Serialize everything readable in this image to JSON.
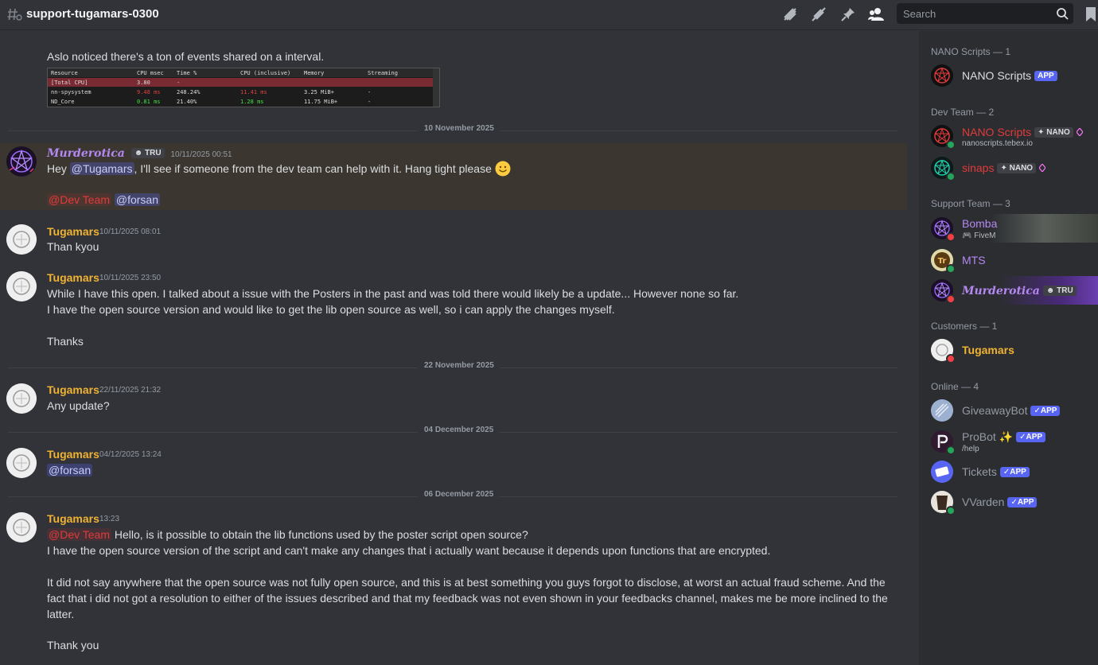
{
  "header": {
    "channel": "support-tugamars-0300",
    "search_placeholder": "Search"
  },
  "messages": {
    "m0_text": "Aslo noticed there's a ton of events shared on a interval.",
    "embed": {
      "headers": [
        "Resource",
        "CPU msec",
        "Time %",
        "CPU (inclusive)",
        "Memory",
        "Streaming"
      ],
      "rows": [
        [
          "[Total CPU]",
          "3.80",
          "-",
          "",
          "",
          ""
        ],
        [
          "nn-spysystem",
          "9.48 ms",
          "248.24%",
          "11.41 ms",
          "3.25 MiB+",
          "-"
        ],
        [
          "ND_Core",
          "0.81 ms",
          "21.40%",
          "1.28 ms",
          "11.75 MiB+",
          "-"
        ]
      ]
    },
    "d1": "10 November 2025",
    "m1": {
      "user": "Murderotica",
      "guild_tag": "TRU",
      "time": "10/11/2025 00:51",
      "l1a": "Hey ",
      "l1_mention": "@Tugamars",
      "l1b": ", I'll see if someone from the dev team can help with it.  Hang tight please",
      "mention_role": "@Dev Team",
      "mention_user": "@forsan"
    },
    "m2": {
      "user": "Tugamars",
      "time": "10/11/2025 08:01",
      "text": "Than kyou"
    },
    "m3": {
      "user": "Tugamars",
      "time": "10/11/2025 23:50",
      "l1": "While I have this open. I talked about a issue with the Posters in the past and was told there would likely be a update... However none so far.",
      "l2": "I have the open source version and would like to get the lib open source as well, so i can apply the changes myself.",
      "l3": "Thanks"
    },
    "d2": "22 November 2025",
    "m4": {
      "user": "Tugamars",
      "time": "22/11/2025 21:32",
      "text": "Any update?"
    },
    "d3": "04 December 2025",
    "m5": {
      "user": "Tugamars",
      "time": "04/12/2025 13:24",
      "mention": "@forsan"
    },
    "d4": "06 December 2025",
    "m6": {
      "user": "Tugamars",
      "time": "13:23",
      "mention_role": "@Dev Team",
      "l1": " Hello, is it possible to obtain the lib functions used by the poster script open source?",
      "l2": "I have the open source version of the script and can't make any changes that i actually want because it depends upon functions that are encrypted.",
      "l3": "It did not say anywhere that the open source was not fully open source, and this is at best something you guys forgot to disclose, at worst an actual fraud scheme. And the",
      "l4": "fact that i did not got a resolution to either of the issues described and that my feedback was not even shown in your feedbacks channel, makes me be more inclined to the",
      "l5": "latter.",
      "l6": "Thank you"
    }
  },
  "members": {
    "g1": "NANO Scripts — 1",
    "g2": "Dev Team — 2",
    "g3": "Support Team — 3",
    "g4": "Customers — 1",
    "g5": "Online — 4",
    "app_tag": "APP",
    "nano_bot": "NANO Scripts",
    "dev1": "NANO Scripts",
    "dev1_tag": "NANO",
    "dev1_sub": "nanoscripts.tebex.io",
    "dev2": "sinaps",
    "dev2_tag": "NANO",
    "sup1": "Bomba",
    "sup1_sub": "FiveM",
    "sup2": "MTS",
    "sup3": "Murderotica",
    "sup3_tag": "TRU",
    "cust1": "Tugamars",
    "on1": "GiveawayBot",
    "on2": "ProBot",
    "on2_sub": "/help",
    "on3": "Tickets",
    "on4": "VVarden"
  },
  "colors": {
    "bg": "#313338",
    "sidebar": "#2b2d31",
    "customer": "#f0b232",
    "dev": "#e03b3b",
    "support": "#b488f0",
    "online": "#23a55a",
    "dnd": "#f23f43",
    "brand": "#5865f2"
  }
}
